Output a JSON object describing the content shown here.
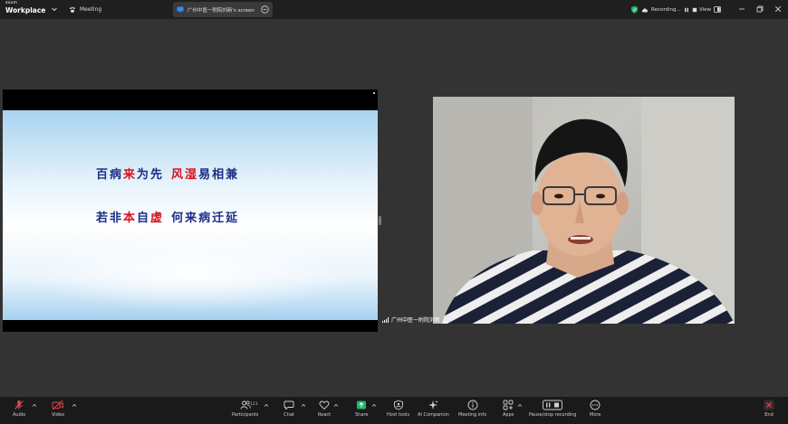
{
  "titlebar": {
    "logo_small": "zoom",
    "logo_big": "Workplace",
    "meeting_label": "Meeting",
    "share_tab_label": "广州中医一附院刘新's screen",
    "recording_label": "Recording...",
    "view_label": "View"
  },
  "slide": {
    "line1": {
      "a": "百病",
      "b": "来",
      "c": "为先",
      "d": "风湿",
      "e": "易相兼"
    },
    "line2": {
      "a": "若非",
      "b": "本",
      "c": "自",
      "d": "虚",
      "e": "何来病迁延"
    }
  },
  "participant": {
    "name": "广州中医一附院刘新"
  },
  "toolbar": {
    "audio": "Audio",
    "video": "Video",
    "participants": "Participants",
    "participants_count": "121",
    "chat": "Chat",
    "react": "React",
    "share": "Share",
    "host_tools": "Host tools",
    "ai_companion": "AI Companion",
    "meeting_info": "Meeting info",
    "apps": "Apps",
    "pause_recording": "Pause/stop recording",
    "more": "More",
    "end": "End"
  },
  "colors": {
    "background": "#333333",
    "titlebar": "#1f1f1f",
    "toolbar": "#1a1a1a",
    "muted_red": "#e04848",
    "share_green": "#1fb86a",
    "slide_blue_text": "#1a2d86",
    "slide_red_text": "#d8111b"
  }
}
